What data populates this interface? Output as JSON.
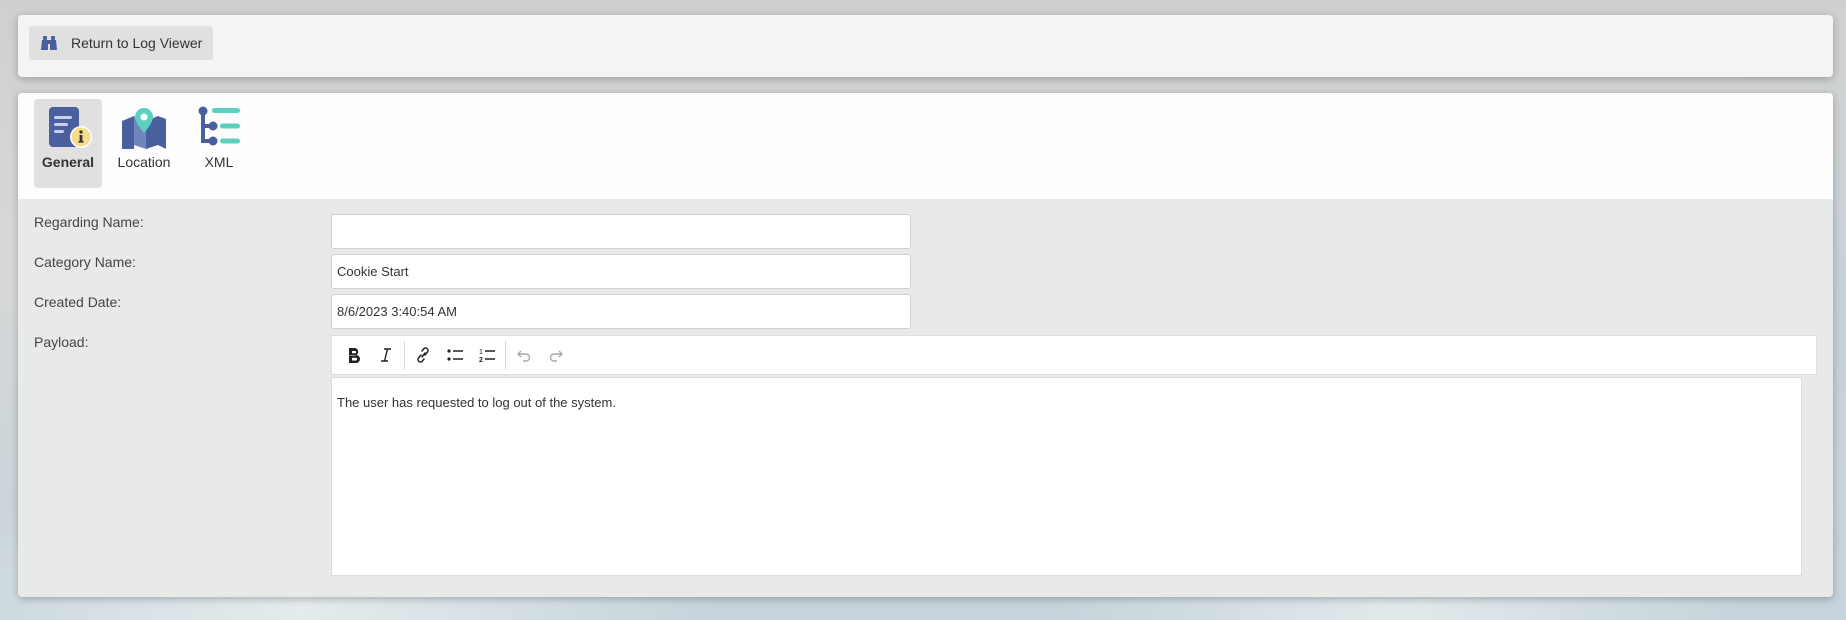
{
  "top_bar": {
    "return_button": {
      "label": "Return to Log Viewer",
      "icon": "binoculars-icon"
    }
  },
  "tabs": [
    {
      "label": "General",
      "icon": "document-info-icon",
      "selected": true
    },
    {
      "label": "Location",
      "icon": "map-pin-icon",
      "selected": false
    },
    {
      "label": "XML",
      "icon": "tree-structure-icon",
      "selected": false
    }
  ],
  "form": {
    "regarding_name": {
      "label": "Regarding Name:",
      "value": ""
    },
    "category_name": {
      "label": "Category Name:",
      "value": "Cookie Start"
    },
    "created_date": {
      "label": "Created Date:",
      "value": "8/6/2023 3:40:54 AM"
    },
    "payload": {
      "label": "Payload:",
      "toolbar": [
        "bold",
        "italic",
        "link",
        "bullet-list",
        "numbered-list",
        "undo",
        "redo"
      ],
      "content": "The user has requested to log out of the system."
    }
  },
  "colors": {
    "icon_blue": "#4a5f9e",
    "icon_teal": "#5ccfc0",
    "info_yellow": "#f5dc8c"
  }
}
